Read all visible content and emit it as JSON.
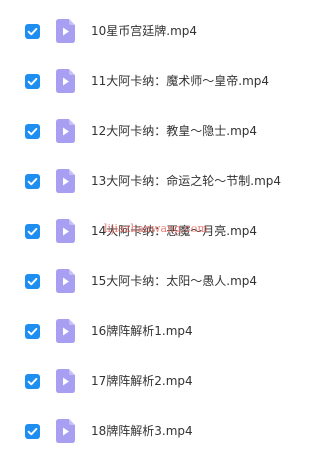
{
  "colors": {
    "checkbox": "#1f8ef1",
    "file_icon": "#a89ef2",
    "file_icon_play": "#ffffff",
    "text": "#333333",
    "watermark": "#e0554b"
  },
  "icons": {
    "checkbox": "checkbox-checked-icon",
    "file": "video-file-icon"
  },
  "files": [
    {
      "name": "10星币宫廷牌.mp4",
      "checked": true
    },
    {
      "name": "11大阿卡纳：魔术师～皇帝.mp4",
      "checked": true
    },
    {
      "name": "12大阿卡纳：教皇～隐士.mp4",
      "checked": true
    },
    {
      "name": "13大阿卡纳：命运之轮～节制.mp4",
      "checked": true
    },
    {
      "name": "14大阿卡纳：恶魔～月亮.mp4",
      "checked": true
    },
    {
      "name": "15大阿卡纳：太阳～愚人.mp4",
      "checked": true
    },
    {
      "name": "16牌阵解析1.mp4",
      "checked": true
    },
    {
      "name": "17牌阵解析2.mp4",
      "checked": true
    },
    {
      "name": "18牌阵解析3.mp4",
      "checked": true
    }
  ],
  "watermark": "lijiazhanwang.com"
}
